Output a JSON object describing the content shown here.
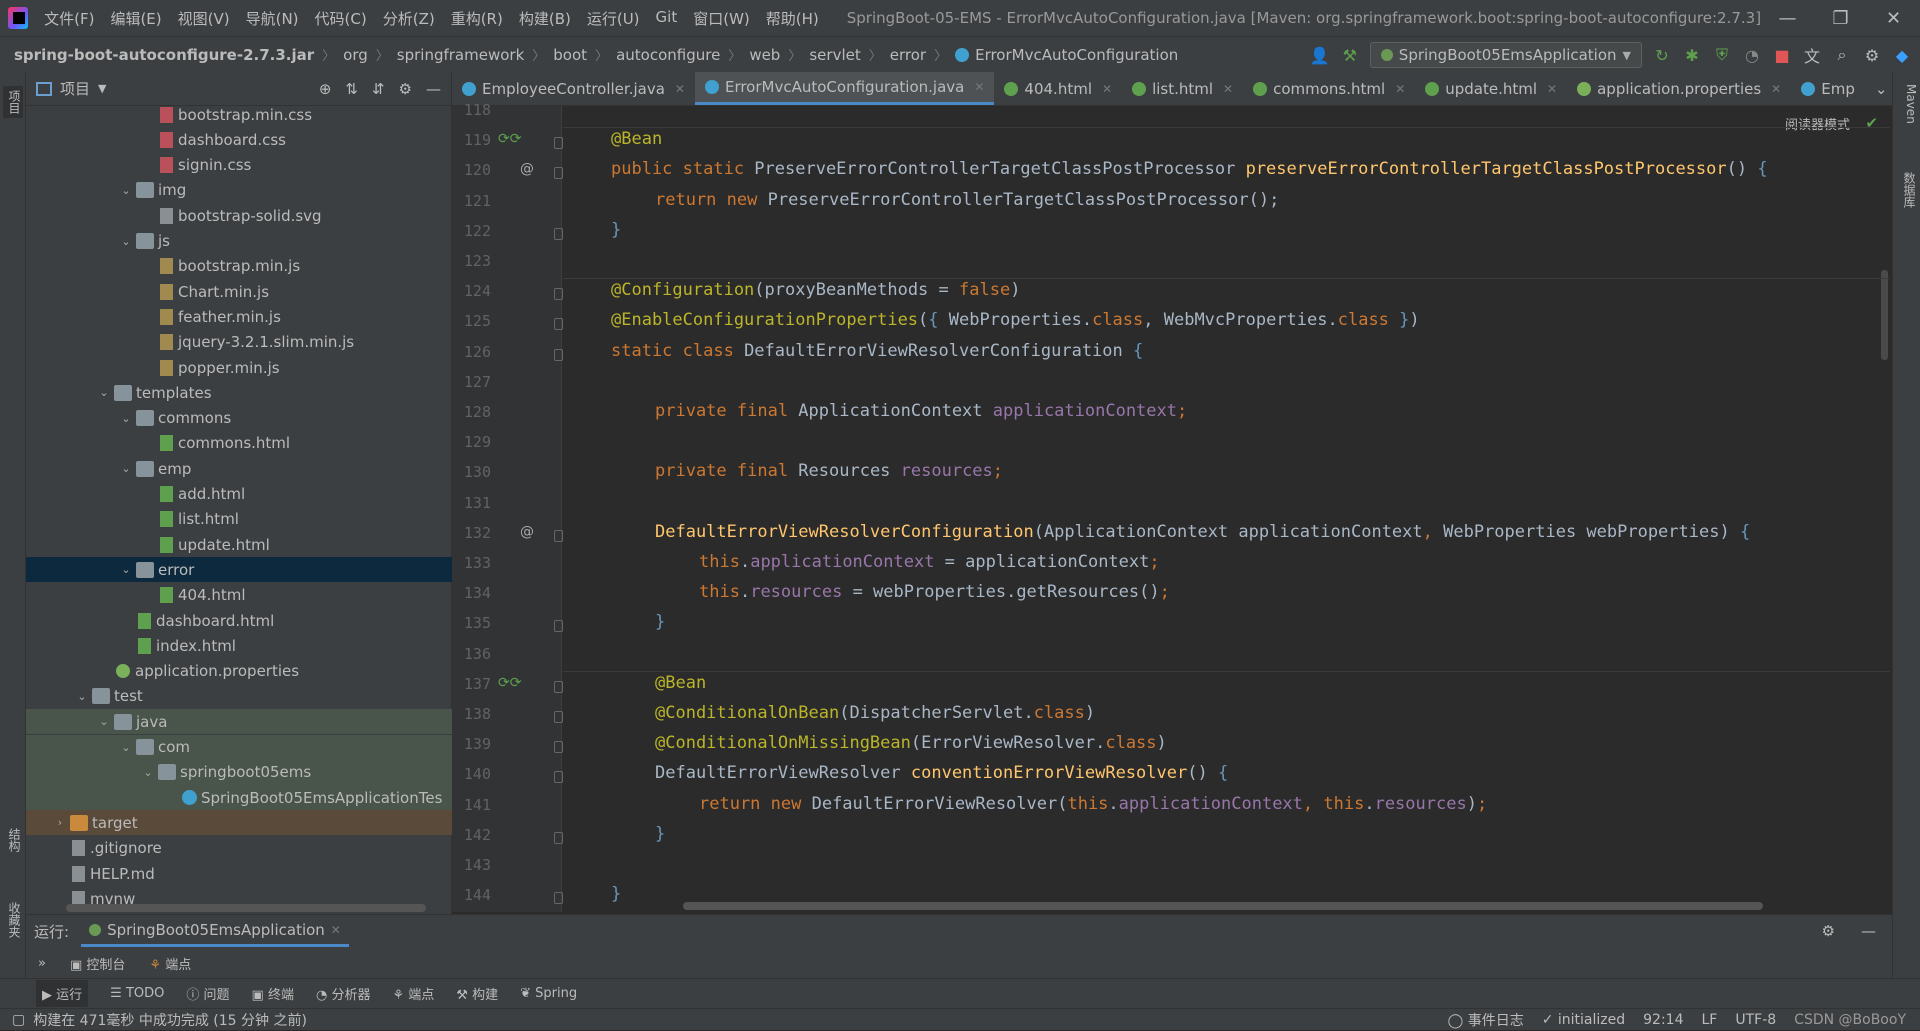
{
  "menu": [
    "文件(F)",
    "编辑(E)",
    "视图(V)",
    "导航(N)",
    "代码(C)",
    "分析(Z)",
    "重构(R)",
    "构建(B)",
    "运行(U)",
    "Git",
    "窗口(W)",
    "帮助(H)"
  ],
  "window_title": "SpringBoot-05-EMS - ErrorMvcAutoConfiguration.java [Maven: org.springframework.boot:spring-boot-autoconfigure:2.7.3]",
  "breadcrumb": [
    "spring-boot-autoconfigure-2.7.3.jar",
    "org",
    "springframework",
    "boot",
    "autoconfigure",
    "web",
    "servlet",
    "error",
    "ErrorMvcAutoConfiguration"
  ],
  "run_config": "SpringBoot05EmsApplication",
  "left_strip": {
    "project": "项目",
    "structure": "结构",
    "favorites": "收藏夹"
  },
  "right_strip": {
    "maven": "Maven",
    "database": "数据库"
  },
  "project_panel": {
    "title": "项目"
  },
  "tree": [
    {
      "label": "bootstrap.min.css",
      "type": "css",
      "indent": 3
    },
    {
      "label": "dashboard.css",
      "type": "css",
      "indent": 3
    },
    {
      "label": "signin.css",
      "type": "css",
      "indent": 3
    },
    {
      "label": "img",
      "type": "folder",
      "indent": 2,
      "expanded": true
    },
    {
      "label": "bootstrap-solid.svg",
      "type": "file",
      "indent": 3
    },
    {
      "label": "js",
      "type": "folder",
      "indent": 2,
      "expanded": true
    },
    {
      "label": "bootstrap.min.js",
      "type": "js",
      "indent": 3
    },
    {
      "label": "Chart.min.js",
      "type": "js",
      "indent": 3
    },
    {
      "label": "feather.min.js",
      "type": "js",
      "indent": 3
    },
    {
      "label": "jquery-3.2.1.slim.min.js",
      "type": "js",
      "indent": 3
    },
    {
      "label": "popper.min.js",
      "type": "js",
      "indent": 3
    },
    {
      "label": "templates",
      "type": "folder",
      "indent": 1,
      "expanded": true
    },
    {
      "label": "commons",
      "type": "folder",
      "indent": 2,
      "expanded": true
    },
    {
      "label": "commons.html",
      "type": "html",
      "indent": 3
    },
    {
      "label": "emp",
      "type": "folder",
      "indent": 2,
      "expanded": true
    },
    {
      "label": "add.html",
      "type": "html",
      "indent": 3
    },
    {
      "label": "list.html",
      "type": "html",
      "indent": 3
    },
    {
      "label": "update.html",
      "type": "html",
      "indent": 3
    },
    {
      "label": "error",
      "type": "folder",
      "indent": 2,
      "expanded": true,
      "selected": true
    },
    {
      "label": "404.html",
      "type": "html",
      "indent": 3
    },
    {
      "label": "dashboard.html",
      "type": "html",
      "indent": 2
    },
    {
      "label": "index.html",
      "type": "html",
      "indent": 2
    },
    {
      "label": "application.properties",
      "type": "props",
      "indent": 1
    },
    {
      "label": "test",
      "type": "folder",
      "indent": 0,
      "expanded": true
    },
    {
      "label": "java",
      "type": "folder-test",
      "indent": 1,
      "expanded": true,
      "test": true
    },
    {
      "label": "com",
      "type": "folder-test",
      "indent": 2,
      "expanded": true,
      "test": true
    },
    {
      "label": "springboot05ems",
      "type": "folder-test",
      "indent": 3,
      "expanded": true,
      "test": true
    },
    {
      "label": "SpringBoot05EmsApplicationTes",
      "type": "java",
      "indent": 4,
      "test": true
    },
    {
      "label": "target",
      "type": "folder-orange",
      "indent": -1,
      "collapsed": true,
      "excluded": true
    },
    {
      "label": ".gitignore",
      "type": "file",
      "indent": -1
    },
    {
      "label": "HELP.md",
      "type": "file",
      "indent": -1
    },
    {
      "label": "mvnw",
      "type": "file",
      "indent": -1
    }
  ],
  "tabs": [
    {
      "label": "EmployeeController.java",
      "active": false,
      "kind": "java"
    },
    {
      "label": "ErrorMvcAutoConfiguration.java",
      "active": true,
      "kind": "java"
    },
    {
      "label": "404.html",
      "active": false,
      "kind": "html"
    },
    {
      "label": "list.html",
      "active": false,
      "kind": "html"
    },
    {
      "label": "commons.html",
      "active": false,
      "kind": "html"
    },
    {
      "label": "update.html",
      "active": false,
      "kind": "html"
    },
    {
      "label": "application.properties",
      "active": false,
      "kind": "props"
    },
    {
      "label": "Emp",
      "active": false,
      "kind": "java"
    }
  ],
  "reader_mode": "阅读器模式",
  "code_lines": [
    {
      "n": "118",
      "t": []
    },
    {
      "n": "119",
      "t": [
        [
          "an",
          "@Bean"
        ]
      ],
      "ind": 1,
      "mark": "bean"
    },
    {
      "n": "120",
      "t": [
        [
          "kw",
          "public static "
        ],
        [
          "",
          "PreserveErrorControllerTargetClassPostProcessor "
        ],
        [
          "fn",
          "preserveErrorControllerTargetClassPostProcessor"
        ],
        [
          "",
          "() "
        ],
        [
          "br",
          "{"
        ]
      ],
      "ind": 1,
      "mark": "at"
    },
    {
      "n": "121",
      "t": [
        [
          "kw",
          "return new "
        ],
        [
          "",
          "PreserveErrorControllerTargetClassPostProcessor();"
        ]
      ],
      "ind": 2
    },
    {
      "n": "122",
      "t": [
        [
          "br",
          "}"
        ]
      ],
      "ind": 1
    },
    {
      "n": "123",
      "t": []
    },
    {
      "n": "124",
      "t": [
        [
          "an",
          "@Configuration"
        ],
        [
          "",
          "(proxyBeanMethods = "
        ],
        [
          "kw",
          "false"
        ],
        [
          "",
          ")"
        ]
      ],
      "ind": 1
    },
    {
      "n": "125",
      "t": [
        [
          "an",
          "@EnableConfigurationProperties"
        ],
        [
          "",
          "("
        ],
        [
          "br",
          "{ "
        ],
        [
          "",
          "WebProperties."
        ],
        [
          "kw",
          "class"
        ],
        [
          "",
          ", WebMvcProperties."
        ],
        [
          "kw",
          "class "
        ],
        [
          "br",
          "}"
        ],
        [
          "",
          ")"
        ]
      ],
      "ind": 1
    },
    {
      "n": "126",
      "t": [
        [
          "kw",
          "static class "
        ],
        [
          "",
          "DefaultErrorViewResolverConfiguration "
        ],
        [
          "br",
          "{"
        ]
      ],
      "ind": 1
    },
    {
      "n": "127",
      "t": []
    },
    {
      "n": "128",
      "t": [
        [
          "kw",
          "private final "
        ],
        [
          "",
          "ApplicationContext "
        ],
        [
          "fld",
          "applicationContext"
        ],
        [
          "kw",
          ";"
        ]
      ],
      "ind": 2
    },
    {
      "n": "129",
      "t": []
    },
    {
      "n": "130",
      "t": [
        [
          "kw",
          "private final "
        ],
        [
          "",
          "Resources "
        ],
        [
          "fld",
          "resources"
        ],
        [
          "kw",
          ";"
        ]
      ],
      "ind": 2
    },
    {
      "n": "131",
      "t": []
    },
    {
      "n": "132",
      "t": [
        [
          "fn",
          "DefaultErrorViewResolverConfiguration"
        ],
        [
          "",
          "(ApplicationContext applicationContext"
        ],
        [
          "kw",
          ", "
        ],
        [
          "",
          "WebProperties webProperties) "
        ],
        [
          "br",
          "{"
        ]
      ],
      "ind": 2,
      "mark": "at"
    },
    {
      "n": "133",
      "t": [
        [
          "kw",
          "this"
        ],
        [
          "",
          "."
        ],
        [
          "fld",
          "applicationContext"
        ],
        [
          "",
          " = applicationContext"
        ],
        [
          "kw",
          ";"
        ]
      ],
      "ind": 3
    },
    {
      "n": "134",
      "t": [
        [
          "kw",
          "this"
        ],
        [
          "",
          "."
        ],
        [
          "fld",
          "resources"
        ],
        [
          "",
          " = webProperties.getResources()"
        ],
        [
          "kw",
          ";"
        ]
      ],
      "ind": 3
    },
    {
      "n": "135",
      "t": [
        [
          "br",
          "}"
        ]
      ],
      "ind": 2
    },
    {
      "n": "136",
      "t": []
    },
    {
      "n": "137",
      "t": [
        [
          "an",
          "@Bean"
        ]
      ],
      "ind": 2,
      "mark": "bean"
    },
    {
      "n": "138",
      "t": [
        [
          "an",
          "@ConditionalOnBean"
        ],
        [
          "",
          "(DispatcherServlet."
        ],
        [
          "kw",
          "class"
        ],
        [
          "",
          ")"
        ]
      ],
      "ind": 2
    },
    {
      "n": "139",
      "t": [
        [
          "an",
          "@ConditionalOnMissingBean"
        ],
        [
          "",
          "(ErrorViewResolver."
        ],
        [
          "kw",
          "class"
        ],
        [
          "",
          ")"
        ]
      ],
      "ind": 2
    },
    {
      "n": "140",
      "t": [
        [
          "",
          "DefaultErrorViewResolver "
        ],
        [
          "fn",
          "conventionErrorViewResolver"
        ],
        [
          "",
          "() "
        ],
        [
          "br",
          "{"
        ]
      ],
      "ind": 2
    },
    {
      "n": "141",
      "t": [
        [
          "kw",
          "return new "
        ],
        [
          "",
          "DefaultErrorViewResolver("
        ],
        [
          "kw",
          "this"
        ],
        [
          "",
          "."
        ],
        [
          "fld",
          "applicationContext"
        ],
        [
          "kw",
          ", this"
        ],
        [
          "",
          "."
        ],
        [
          "fld",
          "resources"
        ],
        [
          "",
          ")"
        ],
        [
          "kw",
          ";"
        ]
      ],
      "ind": 3
    },
    {
      "n": "142",
      "t": [
        [
          "br",
          "}"
        ]
      ],
      "ind": 2
    },
    {
      "n": "143",
      "t": []
    },
    {
      "n": "144",
      "t": [
        [
          "br",
          "}"
        ]
      ],
      "ind": 1
    }
  ],
  "run_panel": {
    "label": "运行:",
    "tab": "SpringBoot05EmsApplication",
    "console": "控制台",
    "endpoints": "端点"
  },
  "bottom_tools": [
    "运行",
    "TODO",
    "问题",
    "终端",
    "分析器",
    "端点",
    "构建",
    "Spring"
  ],
  "status": {
    "message": "构建在 471毫秒 中成功完成 (15 分钟 之前)",
    "event_log": "事件日志",
    "initialized": "initialized",
    "position": "92:14",
    "line_sep": "LF",
    "encoding": "UTF-8",
    "watermark": "CSDN @BoBooY"
  }
}
